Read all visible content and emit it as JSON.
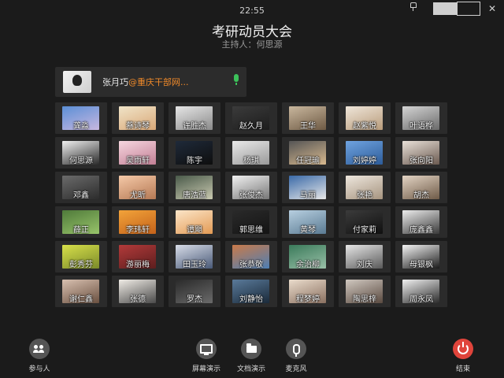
{
  "header": {
    "time": "22:55",
    "title": "考研动员大会",
    "host": "主持人：何思源"
  },
  "speaker": {
    "name": "张月巧",
    "org": "@重庆干部网..."
  },
  "participants": [
    {
      "name": "龚淼",
      "c1": "#5b8fd6",
      "c2": "#c8b7e0"
    },
    {
      "name": "蔡诗琴",
      "c1": "#f0e4c8",
      "c2": "#d9a878"
    },
    {
      "name": "许胜杰",
      "c1": "#e6e6e6",
      "c2": "#8a8a8a"
    },
    {
      "name": "赵久月",
      "c1": "#3b3b3b",
      "c2": "#1d1d1d"
    },
    {
      "name": "王华",
      "c1": "#c9b79e",
      "c2": "#6e5a44"
    },
    {
      "name": "赵紫悦",
      "c1": "#efe6da",
      "c2": "#b89b7a"
    },
    {
      "name": "叶语桦",
      "c1": "#d4d4d4",
      "c2": "#6a6a6a"
    },
    {
      "name": "何思源",
      "c1": "#f0f0f0",
      "c2": "#2a2a2a"
    },
    {
      "name": "吴雨轩",
      "c1": "#f6d6df",
      "c2": "#c27f95"
    },
    {
      "name": "陈宇",
      "c1": "#1f2a3a",
      "c2": "#0e0e0e"
    },
    {
      "name": "杨琪",
      "c1": "#e9e9e9",
      "c2": "#9a9a9a"
    },
    {
      "name": "任冠瑜",
      "c1": "#555555",
      "c2": "#d8b98e"
    },
    {
      "name": "刘婷婷",
      "c1": "#6fa3e0",
      "c2": "#2d5c99"
    },
    {
      "name": "张向阳",
      "c1": "#e8e0d8",
      "c2": "#6b5a50"
    },
    {
      "name": "邓鑫",
      "c1": "#6b6b6b",
      "c2": "#2c2c2c"
    },
    {
      "name": "尤昕",
      "c1": "#f5c9a8",
      "c2": "#b57954"
    },
    {
      "name": "唐浩蓝",
      "c1": "#4a5a4a",
      "c2": "#c9c9b0"
    },
    {
      "name": "张俊杰",
      "c1": "#f1f1f1",
      "c2": "#777777"
    },
    {
      "name": "马丽",
      "c1": "#3a6aa8",
      "c2": "#e8e8e8"
    },
    {
      "name": "张艳",
      "c1": "#eee7de",
      "c2": "#a6947f"
    },
    {
      "name": "胡杰",
      "c1": "#e3d4c4",
      "c2": "#6f5b48"
    },
    {
      "name": "薛正",
      "c1": "#4f7a3a",
      "c2": "#98c46a"
    },
    {
      "name": "李玮轩",
      "c1": "#f2a33a",
      "c2": "#c4621a"
    },
    {
      "name": "谭飓",
      "c1": "#fbe5c8",
      "c2": "#e39a54"
    },
    {
      "name": "郭思维",
      "c1": "#2a2a2a",
      "c2": "#141414"
    },
    {
      "name": "黄琴",
      "c1": "#b7cfe0",
      "c2": "#5a7a92"
    },
    {
      "name": "付家莉",
      "c1": "#3b3b3b",
      "c2": "#101010"
    },
    {
      "name": "庞鑫鑫",
      "c1": "#ececec",
      "c2": "#3a3a3a"
    },
    {
      "name": "彭秀芬",
      "c1": "#d8e04a",
      "c2": "#7a8a2a"
    },
    {
      "name": "游丽梅",
      "c1": "#b33a3a",
      "c2": "#5c1e1e"
    },
    {
      "name": "田玉玲",
      "c1": "#d8dde8",
      "c2": "#4a5a78"
    },
    {
      "name": "张恭敬",
      "c1": "#c97a4a",
      "c2": "#4d7fb5"
    },
    {
      "name": "余治柳",
      "c1": "#3a7a5a",
      "c2": "#9ac0a8"
    },
    {
      "name": "刘庆",
      "c1": "#e6e6e6",
      "c2": "#5a5a5a"
    },
    {
      "name": "母银枫",
      "c1": "#f4f4f4",
      "c2": "#1a1a1a"
    },
    {
      "name": "谢仁鑫",
      "c1": "#d8c0b0",
      "c2": "#6a5040"
    },
    {
      "name": "张德",
      "c1": "#f0ece6",
      "c2": "#4a4a4a"
    },
    {
      "name": "罗杰",
      "c1": "#2a2a2a",
      "c2": "#6a6a6a"
    },
    {
      "name": "刘静怡",
      "c1": "#5a7a9a",
      "c2": "#1a2a3a"
    },
    {
      "name": "程梦婷",
      "c1": "#eadccc",
      "c2": "#8a7060"
    },
    {
      "name": "陶思梓",
      "c1": "#d0c8c0",
      "c2": "#5a4a40"
    },
    {
      "name": "周永凤",
      "c1": "#f0f0f0",
      "c2": "#2a2a2a"
    }
  ],
  "toolbar": {
    "participants_label": "参与人",
    "screen_share_label": "屏幕演示",
    "doc_share_label": "文档演示",
    "mic_label": "麦克风",
    "end_label": "结束"
  },
  "colors": {
    "accent_org": "#f08a2a",
    "mic_active": "#3cc15a",
    "end_button": "#e0443b"
  }
}
